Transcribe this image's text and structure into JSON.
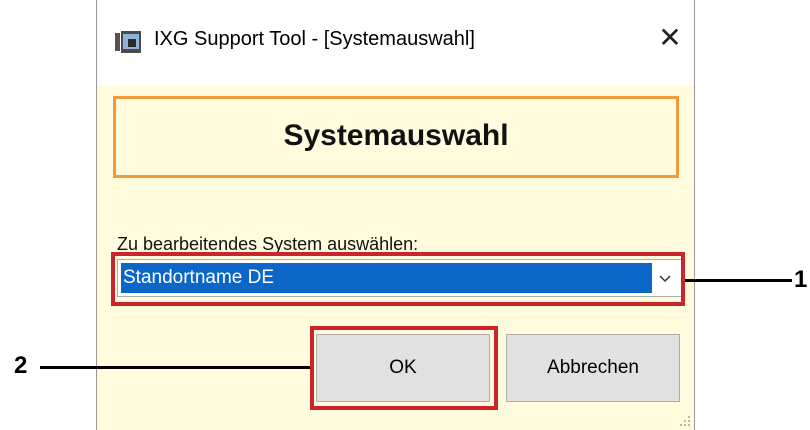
{
  "window": {
    "title": "IXG Support Tool - [Systemauswahl]",
    "close_glyph": "✕",
    "icon": "app-window-icon"
  },
  "banner": {
    "text": "Systemauswahl"
  },
  "form": {
    "label": "Zu bearbeitendes System auswählen:",
    "selected_value": "Standortname DE"
  },
  "buttons": {
    "ok": "OK",
    "cancel": "Abbrechen"
  },
  "callouts": {
    "one": "1",
    "two": "2"
  },
  "colors": {
    "dialog_bg": "#fffbdc",
    "banner_border": "#f29a3a",
    "selection": "#0c66c8",
    "highlight": "#c8262b"
  }
}
